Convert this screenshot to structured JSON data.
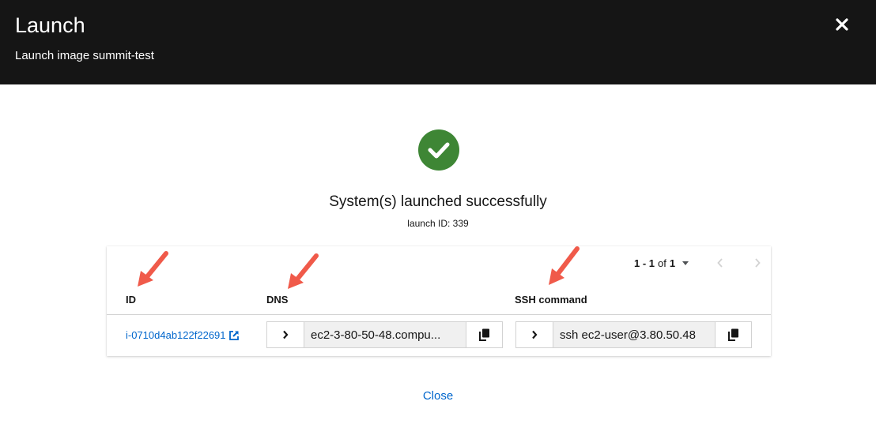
{
  "header": {
    "title": "Launch",
    "subtitle": "Launch image summit-test",
    "close_icon": "close-icon"
  },
  "status": {
    "icon": "check-circle-icon",
    "title": "System(s) launched successfully",
    "launch_id": "launch ID: 339"
  },
  "table": {
    "pagination": {
      "range": "1 - 1",
      "of_label": "of",
      "total": "1"
    },
    "columns": [
      "ID",
      "DNS",
      "SSH command"
    ],
    "rows": [
      {
        "id": "i-0710d4ab122f22691",
        "dns": "ec2-3-80-50-48.compu...",
        "ssh": "ssh ec2-user@3.80.50.48"
      }
    ]
  },
  "footer": {
    "close_label": "Close"
  },
  "colors": {
    "header_bg": "#151515",
    "success": "#3e8635",
    "link": "#0066cc",
    "annotation_arrow": "#f05a4a"
  }
}
